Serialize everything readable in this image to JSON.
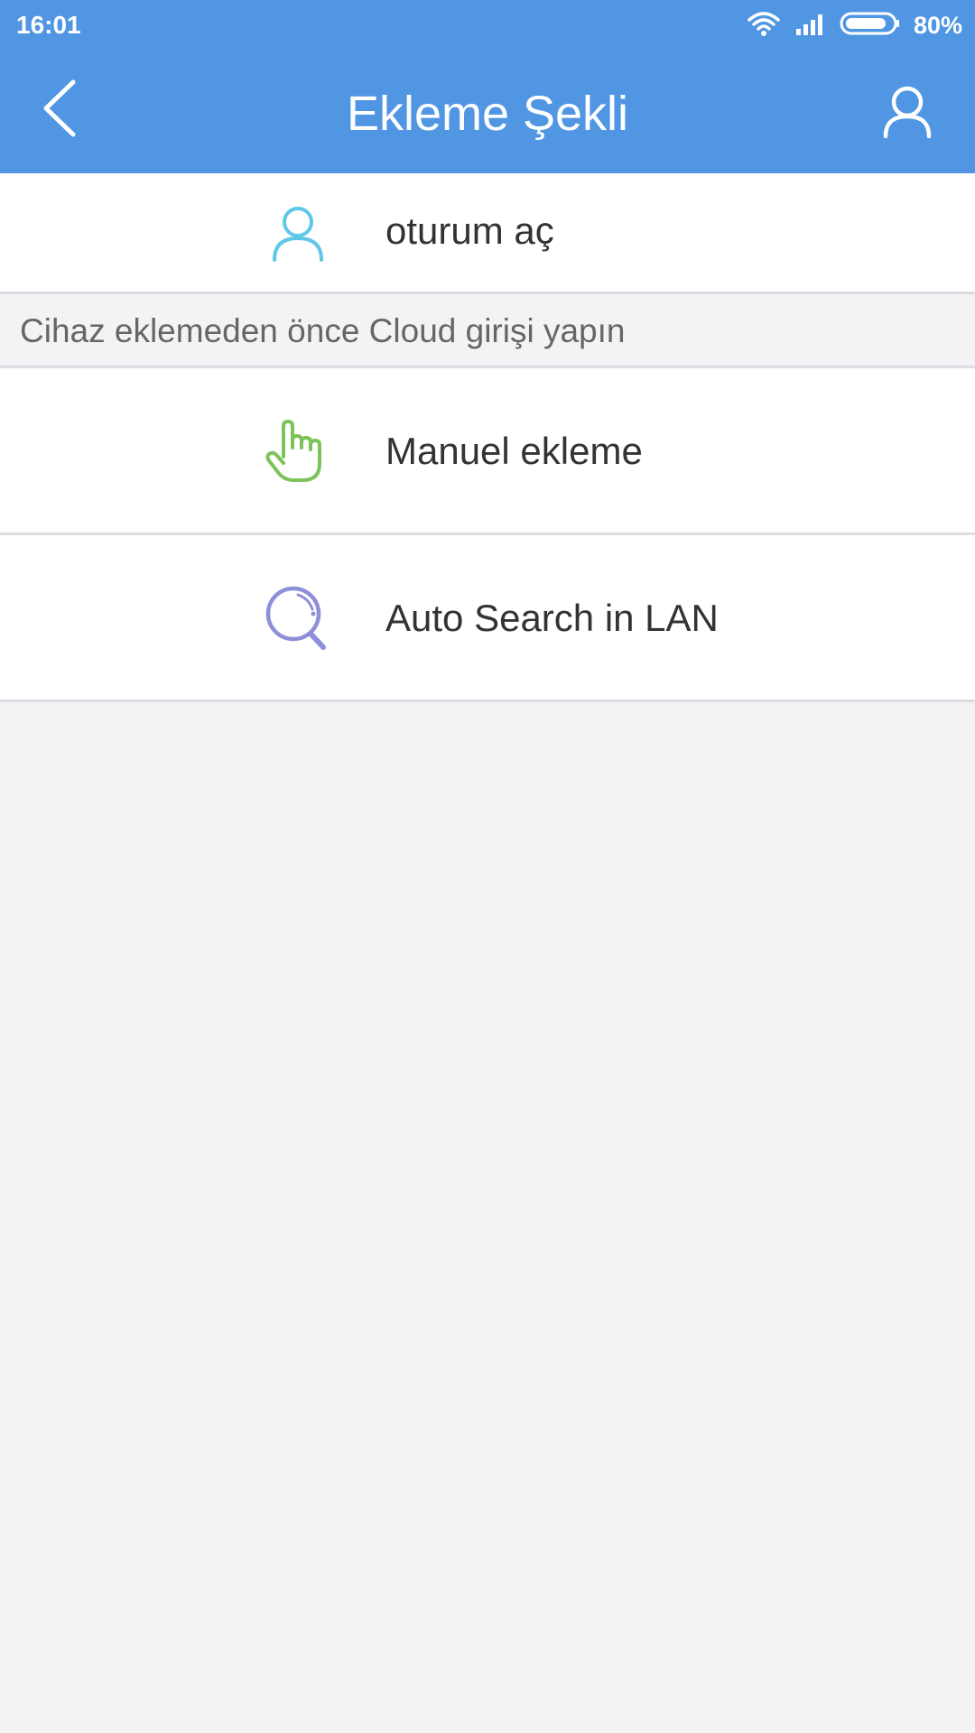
{
  "status_bar": {
    "time": "16:01",
    "battery": "80%",
    "icons": [
      "wifi-icon",
      "signal-icon",
      "battery-icon"
    ]
  },
  "header": {
    "title": "Ekleme Şekli",
    "back_icon": "chevron-left-icon",
    "profile_icon": "user-icon",
    "background_color": "#5096e3"
  },
  "login_row": {
    "label": "oturum aç",
    "icon": "user-icon",
    "icon_color": "#5ec8e6"
  },
  "hint": {
    "text": "Cihaz eklemeden önce Cloud girişi yapın"
  },
  "options": [
    {
      "label": "Manuel ekleme",
      "icon": "pointing-hand-icon",
      "icon_color": "#7dc35a"
    },
    {
      "label": "Auto Search in LAN",
      "icon": "search-icon",
      "icon_color": "#8e8fd9"
    }
  ]
}
